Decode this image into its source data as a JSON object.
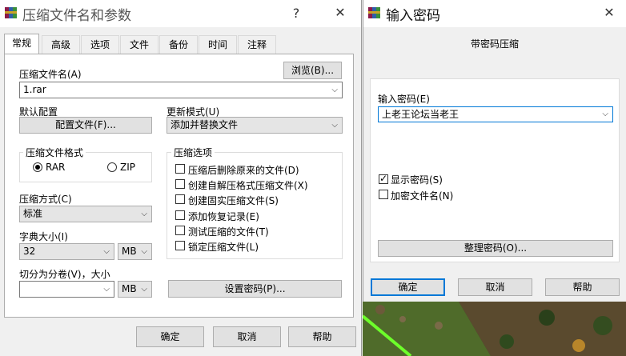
{
  "main_window": {
    "title": "压缩文件名和参数",
    "help_btn": "?",
    "close_btn": "✕",
    "tabs": [
      "常规",
      "高级",
      "选项",
      "文件",
      "备份",
      "时间",
      "注释"
    ],
    "archive_name_label": "压缩文件名(A)",
    "browse_btn": "浏览(B)...",
    "archive_name_value": "1.rar",
    "default_profile_label": "默认配置",
    "profile_btn": "配置文件(F)...",
    "update_mode_label": "更新模式(U)",
    "update_mode_value": "添加并替换文件",
    "format_group_title": "压缩文件格式",
    "format_options": [
      "RAR",
      "ZIP"
    ],
    "format_selected": "RAR",
    "options_group_title": "压缩选项",
    "options": [
      {
        "label": "压缩后删除原来的文件(D)",
        "checked": false
      },
      {
        "label": "创建自解压格式压缩文件(X)",
        "checked": false
      },
      {
        "label": "创建固实压缩文件(S)",
        "checked": false
      },
      {
        "label": "添加恢复记录(E)",
        "checked": false
      },
      {
        "label": "测试压缩的文件(T)",
        "checked": false
      },
      {
        "label": "锁定压缩文件(L)",
        "checked": false
      }
    ],
    "method_label": "压缩方式(C)",
    "method_value": "标准",
    "dict_label": "字典大小(I)",
    "dict_value": "32",
    "dict_unit": "MB",
    "split_label": "切分为分卷(V)，大小",
    "split_value": "",
    "split_unit": "MB",
    "set_password_btn": "设置密码(P)...",
    "ok_btn": "确定",
    "cancel_btn": "取消",
    "help_footer_btn": "帮助"
  },
  "password_window": {
    "title": "输入密码",
    "close_btn": "✕",
    "subtitle": "带密码压缩",
    "password_label": "输入密码(E)",
    "password_value": "上老王论坛当老王",
    "show_password_label": "显示密码(S)",
    "show_password_checked": true,
    "encrypt_names_label": "加密文件名(N)",
    "encrypt_names_checked": false,
    "organize_btn": "整理密码(O)...",
    "ok_btn": "确定",
    "cancel_btn": "取消",
    "help_btn": "帮助"
  },
  "colors": {
    "accent": "#0078d7",
    "window_bg": "#f0f0f0",
    "panel_bg": "#ffffff",
    "button_bg": "#e1e1e1",
    "readonly_combo_bg": "#e5e5e5"
  },
  "icons": {
    "app_icon": "winrar-books-icon",
    "dropdown": "chevron-down-icon"
  }
}
